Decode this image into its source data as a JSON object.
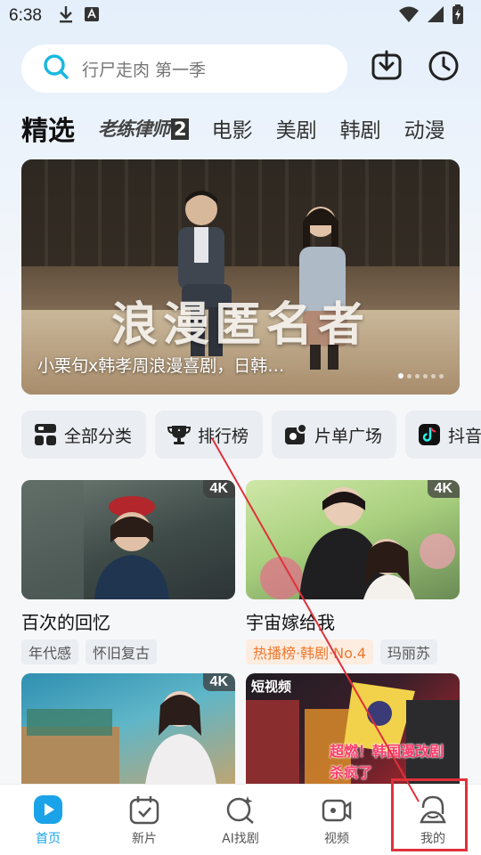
{
  "status_bar": {
    "time": "6:38"
  },
  "search": {
    "placeholder": "行尸走肉 第一季"
  },
  "tabs": [
    {
      "label": "精选"
    },
    {
      "label": "老练律师",
      "num": "2"
    },
    {
      "label": "电影"
    },
    {
      "label": "美剧"
    },
    {
      "label": "韩剧"
    },
    {
      "label": "动漫"
    }
  ],
  "banner": {
    "title": "浪漫匿名者",
    "caption": "小栗旬x韩孝周浪漫喜剧，日韩…",
    "dot_count": 6,
    "active_dot": 0
  },
  "quick_entries": [
    {
      "label": "全部分类"
    },
    {
      "label": "排行榜"
    },
    {
      "label": "片单广场"
    },
    {
      "label": "抖音"
    }
  ],
  "cards": [
    {
      "title": "百次的回忆",
      "badge": "4K",
      "tags": [
        "年代感",
        "怀旧复古"
      ]
    },
    {
      "title": "宇宙嫁给我",
      "badge": "4K",
      "tags": [
        "热播榜·韩剧·No.4",
        "玛丽苏"
      ]
    },
    {
      "badge": "4K"
    },
    {
      "label": "短视频",
      "poster_text": "超燃！韩国漫改剧 杀疯了"
    }
  ],
  "bottom_nav": [
    {
      "label": "首页",
      "icon": "home-play-icon"
    },
    {
      "label": "新片",
      "icon": "calendar-check-icon"
    },
    {
      "label": "AI找剧",
      "icon": "ai-search-icon"
    },
    {
      "label": "视频",
      "icon": "video-camera-icon"
    },
    {
      "label": "我的",
      "icon": "profile-icon"
    }
  ],
  "colors": {
    "accent": "#1aa3e8",
    "hot_tag": "#f0772c",
    "annotation": "#e0313b"
  }
}
